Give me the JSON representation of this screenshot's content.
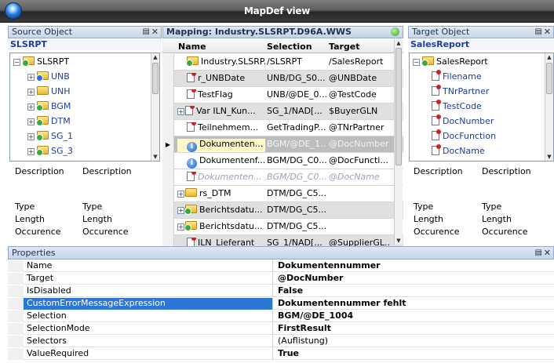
{
  "window": {
    "title": "MapDef view"
  },
  "source_pane": {
    "header": "Source Object",
    "pin": "▤",
    "close": "✕",
    "subtitle": "SLSRPT",
    "tree": [
      {
        "label": "SLSRPT",
        "depth": 0,
        "expander": "−",
        "icon": "folder-green"
      },
      {
        "label": "UNB",
        "depth": 1,
        "expander": "+",
        "icon": "folder-info"
      },
      {
        "label": "UNH",
        "depth": 1,
        "expander": "+",
        "icon": "folder"
      },
      {
        "label": "BGM",
        "depth": 1,
        "expander": "+",
        "icon": "folder-green"
      },
      {
        "label": "DTM",
        "depth": 1,
        "expander": "+",
        "icon": "folder-green"
      },
      {
        "label": "SG_1",
        "depth": 1,
        "expander": "+",
        "icon": "folder-green"
      },
      {
        "label": "SG_3",
        "depth": 1,
        "expander": "+",
        "icon": "folder-green"
      }
    ],
    "props": {
      "description_label": "Description",
      "description_value": "Description",
      "type_label": "Type",
      "type_value": "Type",
      "length_label": "Length",
      "length_value": "Length",
      "occurence_label": "Occurence",
      "occurence_value": "Occurence"
    }
  },
  "mapping_pane": {
    "header": "Mapping: Industry.SLSRPT.D96A.WWS",
    "columns": [
      "Name",
      "Selection",
      "Target"
    ],
    "rows": [
      {
        "name": "Industry.SLSRP...",
        "selection": "/SLSRPT",
        "target": "/SalesReport",
        "icon": "folder-green",
        "style": "",
        "marker": ""
      },
      {
        "name": "r_UNBDate",
        "selection": "UNB/DG_S0...",
        "target": "@UNBDate",
        "icon": "doc",
        "style": "shade",
        "marker": ""
      },
      {
        "name": "TestFlag",
        "selection": "UNB/@DE_0...",
        "target": "@TestCode",
        "icon": "doc",
        "style": "",
        "marker": ""
      },
      {
        "name": "Var ILN_Kun...",
        "selection": "SG_1/NAD[...",
        "target": "$BuyerGLN",
        "icon": "doc",
        "style": "shade",
        "marker": "+"
      },
      {
        "name": "Teilnehmem...",
        "selection": "GetTradingP...",
        "target": "@TNrPartner",
        "icon": "doc",
        "style": "",
        "marker": ""
      },
      {
        "name": "Dokumenten...",
        "selection": "BGM/@DE_1...",
        "target": "@DocNumber",
        "icon": "info",
        "style": "cur",
        "marker": "▶"
      },
      {
        "name": "Dokumentenf...",
        "selection": "BGM/DG_C0...",
        "target": "@DocFuncti...",
        "icon": "info",
        "style": "",
        "marker": ""
      },
      {
        "name": "Dokumenten...",
        "selection": "BGM/DG_C0...",
        "target": "@DocName",
        "icon": "doc",
        "style": "ghost",
        "marker": ""
      },
      {
        "name": "rs_DTM",
        "selection": "DTM/DG_C5...",
        "target": "",
        "icon": "folder",
        "style": "",
        "marker": "+"
      },
      {
        "name": "Berichtsdatu...",
        "selection": "DTM/DG_C5...",
        "target": "",
        "icon": "folder-green",
        "style": "shade",
        "marker": "+"
      },
      {
        "name": "Berichtsdatu...",
        "selection": "DTM/DG_C5...",
        "target": "",
        "icon": "folder-green",
        "style": "",
        "marker": "+"
      },
      {
        "name": "ILN_Lieferant",
        "selection": "SG_1/NAD[...",
        "target": "@SupplierGL...",
        "icon": "doc",
        "style": "shade",
        "marker": ""
      }
    ]
  },
  "target_pane": {
    "header": "Target Object",
    "pin": "▤",
    "close": "✕",
    "subtitle": "SalesReport",
    "tree": [
      {
        "label": "SalesReport",
        "depth": 0,
        "expander": "−",
        "icon": "folder-green"
      },
      {
        "label": "Filename",
        "depth": 1,
        "icon": "doc"
      },
      {
        "label": "TNrPartner",
        "depth": 1,
        "icon": "doc"
      },
      {
        "label": "TestCode",
        "depth": 1,
        "icon": "doc"
      },
      {
        "label": "DocNumber",
        "depth": 1,
        "icon": "doc"
      },
      {
        "label": "DocFunction",
        "depth": 1,
        "icon": "doc"
      },
      {
        "label": "DocName",
        "depth": 1,
        "icon": "doc"
      }
    ],
    "props": {
      "description_label": "Description",
      "description_value": "Description",
      "type_label": "Type",
      "type_value": "Type",
      "length_label": "Length",
      "length_value": "Length",
      "occurence_label": "Occurence",
      "occurence_value": "Occurence"
    }
  },
  "properties": {
    "header": "Properties",
    "pin": "▤",
    "close": "✕",
    "rows": [
      {
        "key": "Name",
        "value": "Dokumentennummer",
        "bold": true
      },
      {
        "key": "Target",
        "value": "@DocNumber",
        "bold": true
      },
      {
        "key": "IsDisabled",
        "value": "False",
        "bold": true
      },
      {
        "key": "CustomErrorMessageExpression",
        "value": "Dokumentennummer fehlt",
        "bold": true,
        "highlight": true
      },
      {
        "key": "Selection",
        "value": "BGM/@DE_1004",
        "bold": true
      },
      {
        "key": "SelectionMode",
        "value": "FirstResult",
        "bold": true
      },
      {
        "key": "Selectors",
        "value": "(Auflistung)",
        "bold": false
      },
      {
        "key": "ValueRequired",
        "value": "True",
        "bold": true
      }
    ]
  },
  "colors": {
    "accent": "#2e76d6",
    "title_bar": "#2b2b2b",
    "tree_label": "#1f3da0"
  }
}
